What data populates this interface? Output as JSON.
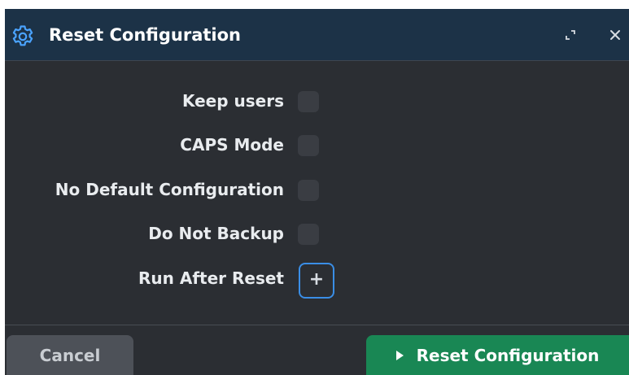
{
  "dialog": {
    "title": "Reset Configuration",
    "title_icon": "gear-icon",
    "expand_icon": "expand-icon",
    "close_icon": "close-icon"
  },
  "options": [
    {
      "label": "Keep users",
      "checked": false
    },
    {
      "label": "CAPS Mode",
      "checked": false
    },
    {
      "label": "No Default Configuration",
      "checked": false
    },
    {
      "label": "Do Not Backup",
      "checked": false
    }
  ],
  "run_after_reset": {
    "label": "Run After Reset",
    "button_label": "+"
  },
  "footer": {
    "cancel_label": "Cancel",
    "reset_label": "Reset Configuration",
    "reset_icon": "play-icon"
  },
  "colors": {
    "titlebar": "#1c3247",
    "body": "#2b2e33",
    "accent": "#3a8ee6",
    "primary_button": "#198754",
    "secondary_button": "#4d5158"
  }
}
